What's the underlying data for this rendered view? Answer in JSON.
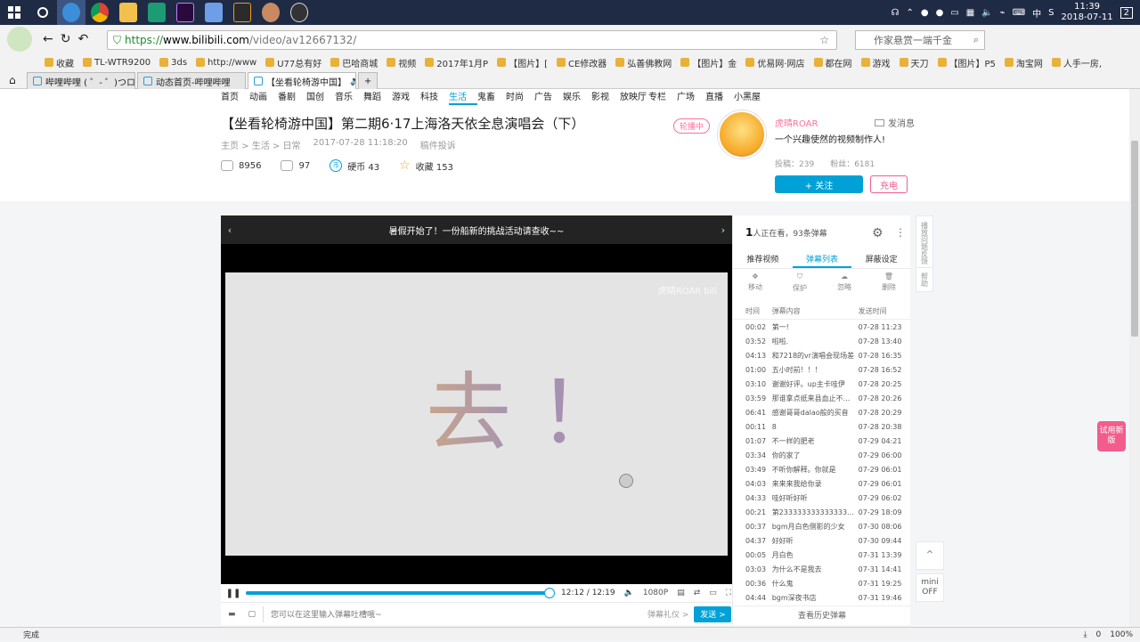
{
  "taskbar": {
    "clock_time": "11:39",
    "clock_date": "2018-07-11",
    "ime": "中",
    "notifications": "2"
  },
  "browser": {
    "url_scheme": "https://",
    "url_host": "www.bilibili.com",
    "url_path": "/video/av12667132/",
    "search_placeholder": "作家悬赏一端千金",
    "bookmarks": [
      "收藏",
      "TL-WTR9200",
      "3ds",
      "http://www",
      "U77总有好",
      "巴哈商城",
      "视频",
      "2017年1月P",
      "【图片】[",
      "CE修改器",
      "弘善佛教网",
      "【图片】金",
      "优易网·网店",
      "都在网",
      "游戏",
      "天刀",
      "【图片】P5",
      "淘宝网",
      "人手一房,"
    ],
    "tabs": [
      {
        "label": "哔哩哔哩 ( ゜- ゜)つロ 干"
      },
      {
        "label": "动态首页-哔哩哔哩"
      },
      {
        "label": "【坐看轮椅游中国】"
      }
    ],
    "status_text": "完成",
    "zoom": "100%",
    "dl_count": "0"
  },
  "site": {
    "nav": [
      "首页",
      "动画",
      "番剧",
      "国创",
      "音乐",
      "舞蹈",
      "游戏",
      "科技",
      "生活",
      "鬼畜",
      "时尚",
      "广告",
      "娱乐",
      "影视",
      "放映厅",
      "专栏",
      "广场",
      "直播",
      "小黑屋"
    ],
    "nav_selected": "生活"
  },
  "video": {
    "title": "【坐看轮椅游中国】第二期6·17上海洛天依全息演唱会（下）",
    "crumb_home": "主页 > 生活 > 日常",
    "date": "2017-07-28 11:18:20",
    "report": "稿件投诉",
    "plays": "8956",
    "danmaku_count": "97",
    "coins": "硬币 43",
    "favorites": "收藏 153"
  },
  "uploader": {
    "live_badge": "轮播中",
    "name": "虎晴ROAR",
    "message": "发消息",
    "desc": "一个兴趣使然的视频制作人!",
    "uploads": "投稿：239",
    "fans": "粉丝：6181",
    "follow": "+ 关注",
    "charge": "充电"
  },
  "player": {
    "announcement": "暑假开始了！一份船新的挑战活动请查收~~",
    "screen_text": "去！",
    "watermark": "虎晴ROAR bili",
    "time": "12:12 / 12:19",
    "quality": "1080P",
    "progress": 0.99,
    "input_placeholder": "您可以在这里输入弹幕吐槽哦~",
    "gift": "弹幕礼仪 >",
    "send": "发送 >"
  },
  "sidebar": {
    "watching_num": "1",
    "watching_text": "人正在看，93条弹幕",
    "tabs": [
      "推荐视频",
      "弹幕列表",
      "屏蔽设定"
    ],
    "tools": [
      "移动",
      "保护",
      "忽略",
      "删除"
    ],
    "head": [
      "时间",
      "弹幕内容",
      "发送时间"
    ],
    "danmaku": [
      {
        "t": "00:02",
        "c": "第一!",
        "d": "07-28 11:23"
      },
      {
        "t": "03:52",
        "c": "啦啦.",
        "d": "07-28 13:40"
      },
      {
        "t": "04:13",
        "c": "和7218的vr演唱会现场差",
        "d": "07-28 16:35"
      },
      {
        "t": "01:00",
        "c": "五小时前！！！",
        "d": "07-28 16:52"
      },
      {
        "t": "03:10",
        "c": "谢谢好评。up主卡哇伊",
        "d": "07-28 20:25"
      },
      {
        "t": "03:59",
        "c": "那谁拿点纸来县血止不...",
        "d": "07-28 20:26"
      },
      {
        "t": "06:41",
        "c": "感谢哥哥dalao般的买音",
        "d": "07-28 20:29"
      },
      {
        "t": "00:11",
        "c": "8",
        "d": "07-28 20:38"
      },
      {
        "t": "01:07",
        "c": "不一样的肥老",
        "d": "07-29 04:21"
      },
      {
        "t": "03:34",
        "c": "你的家了",
        "d": "07-29 06:00"
      },
      {
        "t": "03:49",
        "c": "不听你解释。你就是",
        "d": "07-29 06:01"
      },
      {
        "t": "04:03",
        "c": "来来来我给你录",
        "d": "07-29 06:01"
      },
      {
        "t": "04:33",
        "c": "哇好听好听",
        "d": "07-29 06:02"
      },
      {
        "t": "00:21",
        "c": "第2333333333333333...",
        "d": "07-29 18:09"
      },
      {
        "t": "00:37",
        "c": "bgm月白色侧影的少女",
        "d": "07-30 08:06"
      },
      {
        "t": "04:37",
        "c": "好好听",
        "d": "07-30 09:44"
      },
      {
        "t": "00:05",
        "c": "月白色",
        "d": "07-31 13:39"
      },
      {
        "t": "03:03",
        "c": "为什么不是我去",
        "d": "07-31 14:41"
      },
      {
        "t": "00:36",
        "c": "什么鬼",
        "d": "07-31 19:25"
      },
      {
        "t": "04:44",
        "c": "bgm深夜书店",
        "d": "07-31 19:46"
      }
    ],
    "history": "查看历史弹幕"
  },
  "floating": {
    "report": "播放问题反馈",
    "help": "帮助",
    "new_version": "试用新版",
    "mini": "mini",
    "mini_state": "OFF"
  }
}
